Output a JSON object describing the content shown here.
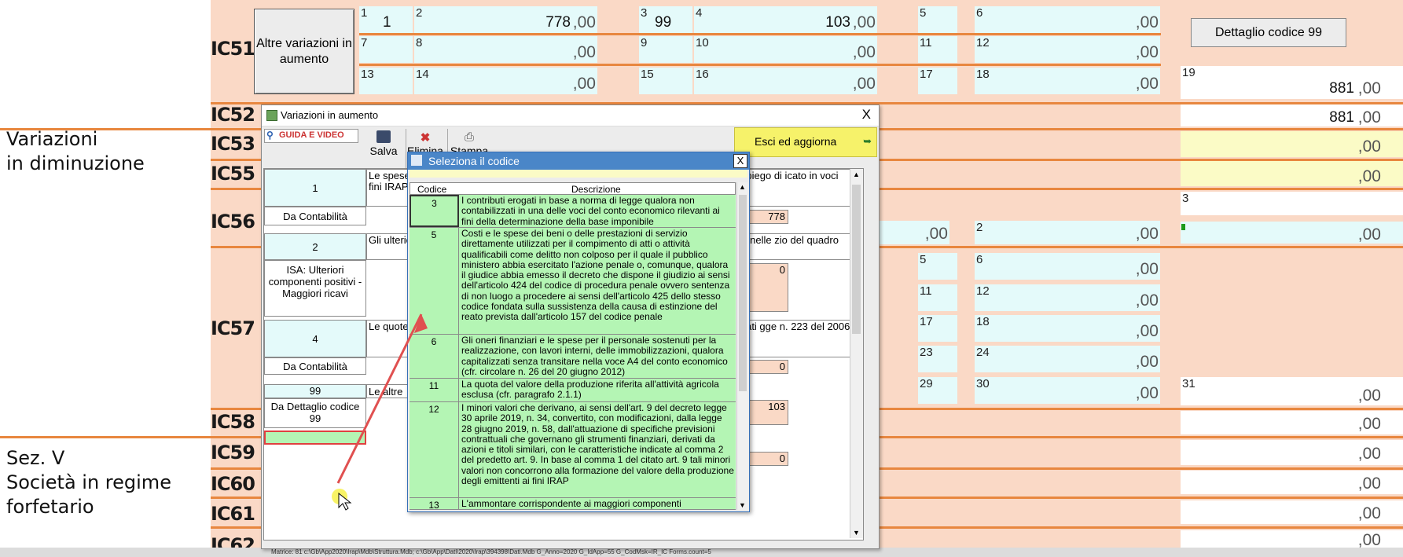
{
  "sections": {
    "variazioni_line1": "Variazioni",
    "variazioni_line2": "in diminuzione",
    "sezv_line1": "Sez. V",
    "sezv_line2": "Società in regime",
    "sezv_line3": "forfetario"
  },
  "row_labels": [
    "IC51",
    "IC52",
    "IC53",
    "IC55",
    "IC56",
    "IC57",
    "IC58",
    "IC59",
    "IC60",
    "IC61",
    "IC62"
  ],
  "ic51": {
    "button_label": "Altre variazioni in aumento",
    "detail_button": "Dettaglio codice 99",
    "numbers": [
      "1",
      "2",
      "3",
      "4",
      "5",
      "6",
      "7",
      "8",
      "9",
      "10",
      "11",
      "12",
      "13",
      "14",
      "15",
      "16",
      "17",
      "18",
      "19"
    ],
    "field1": "1",
    "field2": "778",
    "field3": "99",
    "field4": "103",
    "field19": "881",
    "decimal": ",00"
  },
  "right_col": {
    "ic52": "881",
    "ic56_num": "3",
    "ic56_field_num": "2",
    "ic57_nums": [
      "5",
      "6",
      "11",
      "12",
      "17",
      "18",
      "23",
      "24",
      "29",
      "30",
      "31"
    ]
  },
  "dialog": {
    "title": "Variazioni in aumento",
    "close": "X",
    "guida": "GUIDA E VIDEO",
    "toolbar": {
      "save": "Salva",
      "delete": "Elimina",
      "print": "Stampa"
    },
    "exit_button": "Esci ed aggiorna",
    "rows": [
      {
        "num": "1",
        "text": "Le spese per il personale ai fini IRAP",
        "suffix": "nute per l'impiego di icato in voci rilevanti"
      },
      {
        "num": "2",
        "text": "Gli ulteriori scritture",
        "suffix": "non annotati nelle zio del quadro"
      },
      {
        "num": "4",
        "text": "Le quote strumenti (cfr. ci",
        "suffix": "za di fabbricati gge n. 223 del 2006"
      },
      {
        "num": "99",
        "text": "Le altre"
      }
    ],
    "da_contabilita": "Da Contabilità",
    "isa_label": "ISA: Ulteriori componenti positivi - Maggiori ricavi",
    "da_dettaglio": "Da Dettaglio codice 99",
    "values": [
      "778",
      "0",
      "0",
      "103",
      "0"
    ]
  },
  "popup": {
    "title": "Seleziona il codice",
    "close": "X",
    "col_codice": "Codice",
    "col_descrizione": "Descrizione",
    "items": [
      {
        "code": "3",
        "desc": "I contributi erogati in base a norma di legge qualora non contabilizzati in una delle voci del conto economico rilevanti ai fini della determinazione della base imponibile"
      },
      {
        "code": "5",
        "desc": "Costi e le spese dei beni o delle prestazioni di servizio direttamente utilizzati per il compimento di atti o attività qualificabili come delitto non colposo per il quale il pubblico ministero abbia esercitato l'azione penale o, comunque, qualora il giudice abbia emesso il decreto che dispone il giudizio ai sensi dell'articolo 424 del codice di procedura penale ovvero sentenza di non luogo a procedere ai sensi dell'articolo 425 dello stesso codice fondata sulla sussistenza della causa di estinzione del reato prevista dall'articolo 157 del codice penale"
      },
      {
        "code": "6",
        "desc": "Gli oneri finanziari e le spese per il personale sostenuti per la realizzazione, con lavori interni, delle immobilizzazioni, qualora capitalizzati senza transitare nella voce A4 del conto economico (cfr. circolare n. 26 del 20 giugno 2012)"
      },
      {
        "code": "11",
        "desc": "La quota del valore della produzione riferita all'attività agricola esclusa (cfr. paragrafo 2.1.1)"
      },
      {
        "code": "12",
        "desc": "I minori valori che derivano, ai sensi dell'art. 9 del decreto legge 30 aprile 2019, n. 34, convertito, con modificazioni, dalla legge 28 giugno 2019, n. 58, dall'attuazione di specifiche previsioni contrattuali che governano gli strumenti finanziari, derivati da azioni e titoli similari, con le caratteristiche indicate al comma 2 del predetto art. 9. In base al comma 1 del citato art. 9 tali minori valori non concorrono alla formazione del valore della produzione degli emittenti ai fini IRAP"
      },
      {
        "code": "13",
        "desc": "L'ammontare corrispondente ai maggiori componenti"
      }
    ]
  },
  "status_bar": "Matrice: 81        c:\\Gb\\App2020\\Irap\\Mdb\\Struttura.Mdb; c:\\Gb\\App\\Dati\\2020\\Irap\\394398\\Dati.Mdb G_Anno=2020 G_IdApp=55 G_CodMsk=IR_IC Forms.count=5",
  "colors": {
    "peach": "#fad9c6",
    "orange_line": "#e8873f",
    "cyan": "#e4fafa",
    "green": "#b4f5b4",
    "popup_title": "#4a86c8",
    "yellow": "#fbfbc6"
  }
}
